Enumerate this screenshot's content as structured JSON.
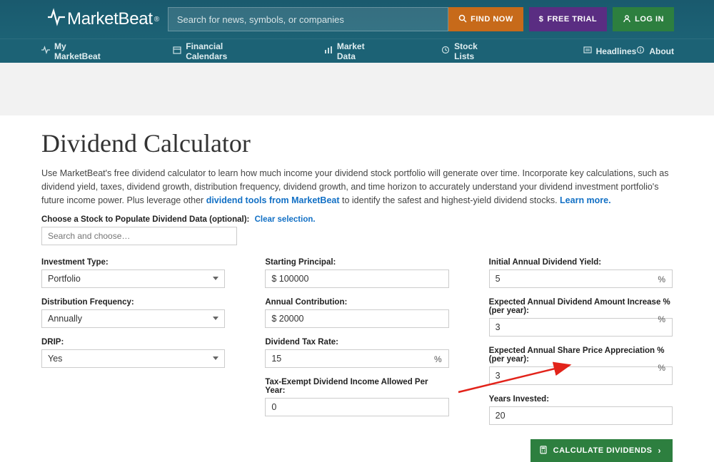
{
  "header": {
    "logo_text": "MarketBeat",
    "search_placeholder": "Search for news, symbols, or companies",
    "find_now": "FIND NOW",
    "free_trial": "FREE TRIAL",
    "log_in": "LOG IN"
  },
  "nav": {
    "my_marketbeat": "My MarketBeat",
    "financial_calendars": "Financial Calendars",
    "market_data": "Market Data",
    "stock_lists": "Stock Lists",
    "headlines": "Headlines",
    "about": "About"
  },
  "page": {
    "title": "Dividend Calculator",
    "intro_1": "Use MarketBeat's free dividend calculator to learn how much income your dividend stock portfolio will generate over time. Incorporate key calculations, such as dividend yield, taxes, dividend growth, distribution frequency, dividend growth, and time horizon to accurately understand your dividend investment portfolio's future income power. Plus leverage other ",
    "intro_link1": "dividend tools from MarketBeat",
    "intro_2": " to identify the safest and highest-yield dividend stocks. ",
    "intro_link2": "Learn more.",
    "choose_label": "Choose a Stock to Populate Dividend Data (optional):",
    "clear_selection": "Clear selection.",
    "stock_search_placeholder": "Search and choose…"
  },
  "form": {
    "investment_type": {
      "label": "Investment Type:",
      "value": "Portfolio"
    },
    "distribution_frequency": {
      "label": "Distribution Frequency:",
      "value": "Annually"
    },
    "drip": {
      "label": "DRIP:",
      "value": "Yes"
    },
    "starting_principal": {
      "label": "Starting Principal:",
      "value": "$ 100000"
    },
    "annual_contribution": {
      "label": "Annual Contribution:",
      "value": "$ 20000"
    },
    "dividend_tax_rate": {
      "label": "Dividend Tax Rate:",
      "value": "15",
      "suffix": "%"
    },
    "tax_exempt": {
      "label": "Tax-Exempt Dividend Income Allowed Per Year:",
      "value": "0"
    },
    "initial_yield": {
      "label": "Initial Annual Dividend Yield:",
      "value": "5",
      "suffix": "%"
    },
    "expected_div_increase": {
      "label": "Expected Annual Dividend Amount Increase % (per year):",
      "value": "3",
      "suffix": "%"
    },
    "expected_share_appreciation": {
      "label": "Expected Annual Share Price Appreciation % (per year):",
      "value": "3",
      "suffix": "%"
    },
    "years_invested": {
      "label": "Years Invested:",
      "value": "20"
    },
    "calculate_label": "CALCULATE DIVIDENDS"
  }
}
